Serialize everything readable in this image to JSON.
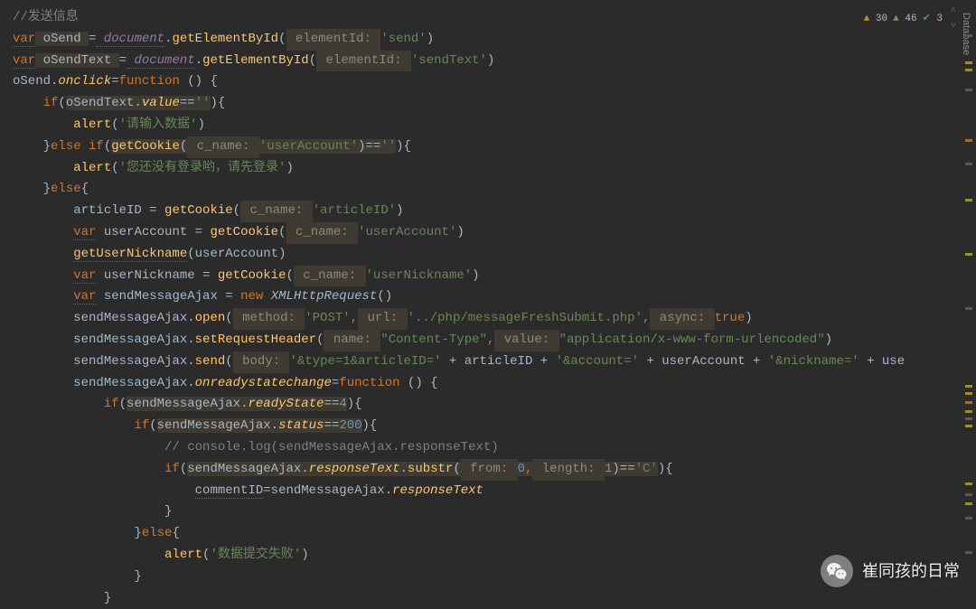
{
  "status": {
    "warn_count": "30",
    "hint_count": "46",
    "ok_count": "3"
  },
  "sidebar": {
    "label": "Database"
  },
  "watermark": {
    "text": "崔同孩的日常"
  },
  "code": {
    "l1": {
      "comment": "//发送信息"
    },
    "l2": {
      "kw_var": "var",
      "id": " oSend ",
      "op": "=",
      "doc": " document",
      "dot": ".",
      "fn": "getElementById",
      "p1": "(",
      "hint": " elementId: ",
      "s": "'send'",
      "p2": ")"
    },
    "l3": {
      "kw_var": "var",
      "id": " oSendText ",
      "op": "=",
      "doc": " document",
      "dot": ".",
      "fn": "getElementById",
      "p1": "(",
      "hint": " elementId: ",
      "s": "'sendText'",
      "p2": ")"
    },
    "l4": {
      "a": "oSend",
      "b": ".",
      "c": "onclick",
      "d": "=",
      "e": "function ",
      "f": "() {"
    },
    "l5": {
      "ind": "    ",
      "kw": "if",
      "p1": "(",
      "a": "oSendText",
      "b": ".",
      "c": "value",
      "d": "==",
      "s": "''",
      "p2": "){"
    },
    "l6": {
      "ind": "        ",
      "fn": "alert",
      "p1": "(",
      "s": "'请输入数据'",
      "p2": ")"
    },
    "l7": {
      "ind": "    ",
      "p1": "}",
      "kw": "else if",
      "p2": "(",
      "fn": "getCookie",
      "p3": "(",
      "hint": " c_name: ",
      "s": "'userAccount'",
      "p4": ")==",
      "s2": "''",
      "p5": "){"
    },
    "l8": {
      "ind": "        ",
      "fn": "alert",
      "p1": "(",
      "s": "'您还没有登录哟，请先登录'",
      "p2": ")"
    },
    "l9": {
      "ind": "    ",
      "p1": "}",
      "kw": "else",
      "p2": "{"
    },
    "l10": {
      "ind": "        ",
      "a": "articleID ",
      "b": "= ",
      "fn": "getCookie",
      "p1": "(",
      "hint": " c_name: ",
      "s": "'articleID'",
      "p2": ")"
    },
    "l11": {
      "ind": "        ",
      "kw": "var",
      "a": " userAccount ",
      "b": "= ",
      "fn": "getCookie",
      "p1": "(",
      "hint": " c_name: ",
      "s": "'userAccount'",
      "p2": ")"
    },
    "l12": {
      "ind": "        ",
      "fn": "getUserNickname",
      "p1": "(",
      "a": "userAccount",
      "p2": ")"
    },
    "l13": {
      "ind": "        ",
      "kw": "var",
      "a": " userNickname ",
      "b": "= ",
      "fn": "getCookie",
      "p1": "(",
      "hint": " c_name: ",
      "s": "'userNickname'",
      "p2": ")"
    },
    "l14": {
      "ind": "        ",
      "kw": "var",
      "a": " sendMessageAjax ",
      "b": "= ",
      "new": "new ",
      "cls": "XMLHttpRequest",
      "p": "()"
    },
    "l15": {
      "ind": "        ",
      "a": "sendMessageAjax",
      "b": ".",
      "fn": "open",
      "p1": "(",
      "h1": " method: ",
      "s1": "'POST'",
      "c": ",",
      "h2": " url: ",
      "s2": "'../php/messageFreshSubmit.php'",
      "c2": ",",
      "h3": " async: ",
      "v": "true",
      "p2": ")"
    },
    "l16": {
      "ind": "        ",
      "a": "sendMessageAjax",
      "b": ".",
      "fn": "setRequestHeader",
      "p1": "(",
      "h1": " name: ",
      "s1": "\"Content-Type\"",
      "c": ",",
      "h2": " value: ",
      "s2": "\"application/x-www-form-urlencoded\"",
      "p2": ")"
    },
    "l17": {
      "ind": "        ",
      "a": "sendMessageAjax",
      "b": ".",
      "fn": "send",
      "p1": "(",
      "h1": " body: ",
      "s1": "'&type=1&articleID='",
      "op1": " + ",
      "v1": "articleID",
      "op2": " + ",
      "s2": "'&account='",
      "op3": " + ",
      "v2": "userAccount",
      "op4": " + ",
      "s3": "'&nickname='",
      "op5": " + ",
      "v3": "use"
    },
    "l18": {
      "ind": "        ",
      "a": "sendMessageAjax",
      "b": ".",
      "c": "onreadystatechange",
      "d": "=",
      "e": "function ",
      "f": "() {"
    },
    "l19": {
      "ind": "            ",
      "kw": "if",
      "p1": "(",
      "a": "sendMessageAjax",
      "b": ".",
      "c": "readyState",
      "d": "==",
      "n": "4",
      "p2": "){"
    },
    "l20": {
      "ind": "                ",
      "kw": "if",
      "p1": "(",
      "a": "sendMessageAjax",
      "b": ".",
      "c": "status",
      "d": "==",
      "n": "200",
      "p2": "){"
    },
    "l21": {
      "ind": "                    ",
      "c": "// console.log(sendMessageAjax.responseText)"
    },
    "l22": {
      "ind": "                    ",
      "kw": "if",
      "p1": "(",
      "a": "sendMessageAjax",
      "b": ".",
      "c": "responseText",
      "d": ".",
      "fn": "substr",
      "p2": "(",
      "h1": " from: ",
      "n1": "0",
      "cma": ",",
      "h2": " length: ",
      "n2": "1",
      "p3": ")==",
      "s": "'C'",
      "p4": "){"
    },
    "l23": {
      "ind": "                        ",
      "a": "commentID",
      "b": "=",
      "c": "sendMessageAjax",
      "d": ".",
      "e": "responseText"
    },
    "l24": {
      "ind": "                    ",
      "p": "}"
    },
    "l25": {
      "ind": "                ",
      "p1": "}",
      "kw": "else",
      "p2": "{"
    },
    "l26": {
      "ind": "                    ",
      "fn": "alert",
      "p1": "(",
      "s": "'数据提交失败'",
      "p2": ")"
    },
    "l27": {
      "ind": "                ",
      "p": "}"
    },
    "l28": {
      "ind": "            ",
      "p": "}"
    }
  }
}
